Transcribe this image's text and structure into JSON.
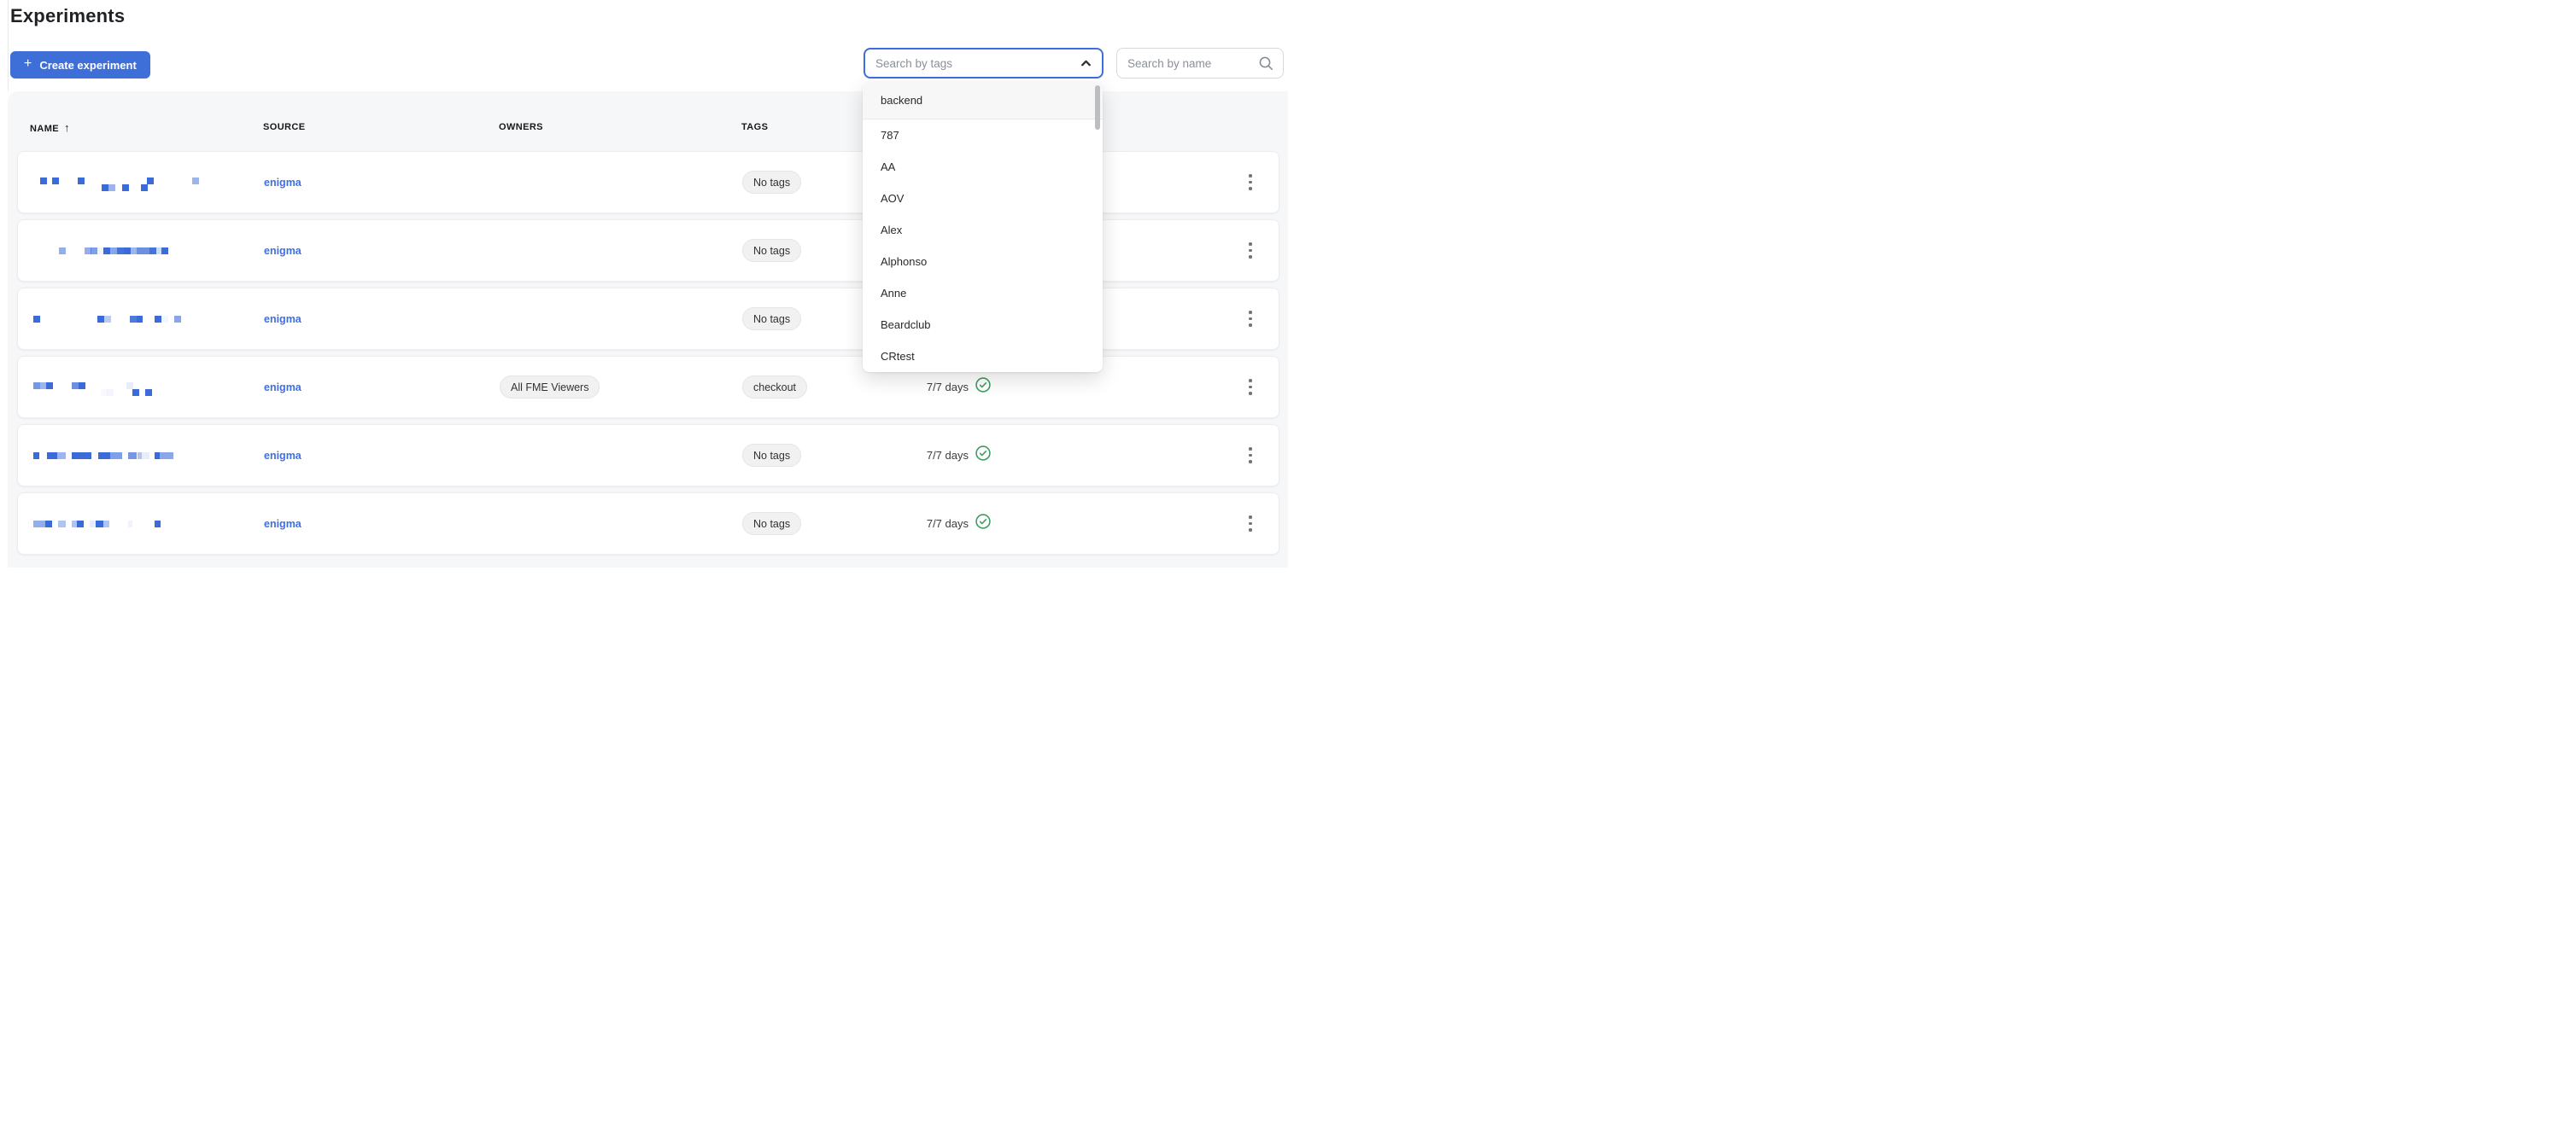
{
  "page": {
    "title": "Experiments"
  },
  "toolbar": {
    "create_button": {
      "label": "Create experiment",
      "plus_icon": "+"
    },
    "tags_search": {
      "placeholder": "Search by tags",
      "value": ""
    },
    "name_search": {
      "placeholder": "Search by name",
      "value": ""
    }
  },
  "tags_dropdown": {
    "items": [
      "backend",
      "787",
      "AA",
      "AOV",
      "Alex",
      "Alphonso",
      "Anne",
      "Beardclub",
      "CRtest"
    ],
    "highlighted_index": 0
  },
  "table": {
    "sort_arrow": "↑",
    "columns": [
      {
        "label": "NAME"
      },
      {
        "label": "SOURCE"
      },
      {
        "label": "OWNERS"
      },
      {
        "label": "TAGS"
      }
    ],
    "rows": [
      {
        "name_redacted_blocks": [
          [
            1,
            1,
            1,
            0
          ],
          [
            2.8,
            1,
            1,
            0
          ],
          [
            6.5,
            1,
            1,
            0
          ],
          [
            10,
            1,
            1,
            1
          ],
          [
            11,
            1,
            0.5,
            1
          ],
          [
            13,
            1,
            1,
            1
          ],
          [
            15.7,
            1,
            1,
            1
          ],
          [
            16.6,
            1,
            1,
            0
          ],
          [
            23.2,
            1,
            0.5,
            0
          ]
        ],
        "source": "enigma",
        "owners": [],
        "tags": [
          "No tags"
        ],
        "days": null
      },
      {
        "name_redacted_blocks": [
          [
            3.7,
            1,
            0.55,
            0
          ],
          [
            7.45,
            1,
            0.55,
            0
          ],
          [
            8.4,
            1,
            0.65,
            0
          ],
          [
            9.3,
            1,
            0.08,
            0
          ],
          [
            10.3,
            1,
            1,
            0
          ],
          [
            11.3,
            1,
            0.6,
            0
          ],
          [
            12.3,
            1,
            0.95,
            0
          ],
          [
            13.2,
            1,
            1,
            0
          ],
          [
            14.1,
            1,
            0.5,
            0
          ],
          [
            15.1,
            1.9,
            0.75,
            0
          ],
          [
            17,
            1,
            0.95,
            0
          ],
          [
            17.9,
            1,
            0.25,
            0
          ],
          [
            18.8,
            1,
            1,
            0
          ]
        ],
        "source": "enigma",
        "owners": [],
        "tags": [
          "No tags"
        ],
        "days": null
      },
      {
        "name_redacted_blocks": [
          [
            0,
            1,
            1,
            0
          ],
          [
            9.4,
            1,
            1,
            0
          ],
          [
            10.4,
            1,
            0.35,
            0
          ],
          [
            14.1,
            1,
            0.9,
            0
          ],
          [
            15.1,
            0.9,
            1,
            0
          ],
          [
            17.8,
            1,
            1,
            0
          ],
          [
            18.8,
            1,
            0.06,
            0
          ],
          [
            20.6,
            1,
            0.6,
            0
          ]
        ],
        "source": "enigma",
        "owners": [],
        "tags": [
          "No tags"
        ],
        "days": null
      },
      {
        "name_redacted_blocks": [
          [
            0,
            1,
            0.7,
            0
          ],
          [
            0.95,
            1,
            0.5,
            0
          ],
          [
            1.9,
            1,
            1,
            0
          ],
          [
            5.6,
            1,
            0.75,
            0
          ],
          [
            6.6,
            1,
            1,
            0
          ],
          [
            13.6,
            1,
            0.12,
            0
          ],
          [
            9.85,
            1,
            0.04,
            1
          ],
          [
            10.8,
            1,
            0.06,
            1
          ],
          [
            14.5,
            1,
            1,
            1
          ],
          [
            16.4,
            1,
            1,
            1
          ]
        ],
        "source": "enigma",
        "owners": [
          "All FME Viewers"
        ],
        "tags": [
          "checkout"
        ],
        "days": "7/7 days"
      },
      {
        "name_redacted_blocks": [
          [
            0,
            0.9,
            1,
            0
          ],
          [
            2,
            1.5,
            1,
            0
          ],
          [
            3.5,
            1.25,
            0.5,
            0
          ],
          [
            5.6,
            2.9,
            1,
            0
          ],
          [
            9.5,
            1.7,
            1,
            0
          ],
          [
            11.2,
            1.8,
            0.65,
            0
          ],
          [
            13.9,
            1.25,
            0.7,
            0
          ],
          [
            15.2,
            0.7,
            0.4,
            0
          ],
          [
            15.9,
            1.1,
            0.12,
            0
          ],
          [
            17.7,
            0.8,
            1,
            0
          ],
          [
            18.5,
            2,
            0.6,
            0
          ]
        ],
        "source": "enigma",
        "owners": [],
        "tags": [
          "No tags"
        ],
        "days": "7/7 days"
      },
      {
        "name_redacted_blocks": [
          [
            0,
            1.7,
            0.55,
            0
          ],
          [
            1.7,
            1,
            1,
            0
          ],
          [
            3.6,
            1.1,
            0.4,
            0
          ],
          [
            5.6,
            0.8,
            0.4,
            0
          ],
          [
            6.4,
            1,
            1,
            0
          ],
          [
            8.3,
            0.8,
            0.12,
            0
          ],
          [
            9.1,
            1.1,
            1,
            0
          ],
          [
            10.2,
            0.9,
            0.4,
            0
          ],
          [
            13.9,
            0.6,
            0.08,
            0
          ],
          [
            17.8,
            0.8,
            1,
            0
          ]
        ],
        "source": "enigma",
        "owners": [],
        "tags": [
          "No tags"
        ],
        "days": "7/7 days"
      }
    ]
  },
  "colors": {
    "accent_blue": "#3e6fd9",
    "link_blue": "#3f6fdd",
    "redaction_blue": "#3a6bd8",
    "success_green": "#3f9d63",
    "pane_bg": "#f6f7f9"
  }
}
